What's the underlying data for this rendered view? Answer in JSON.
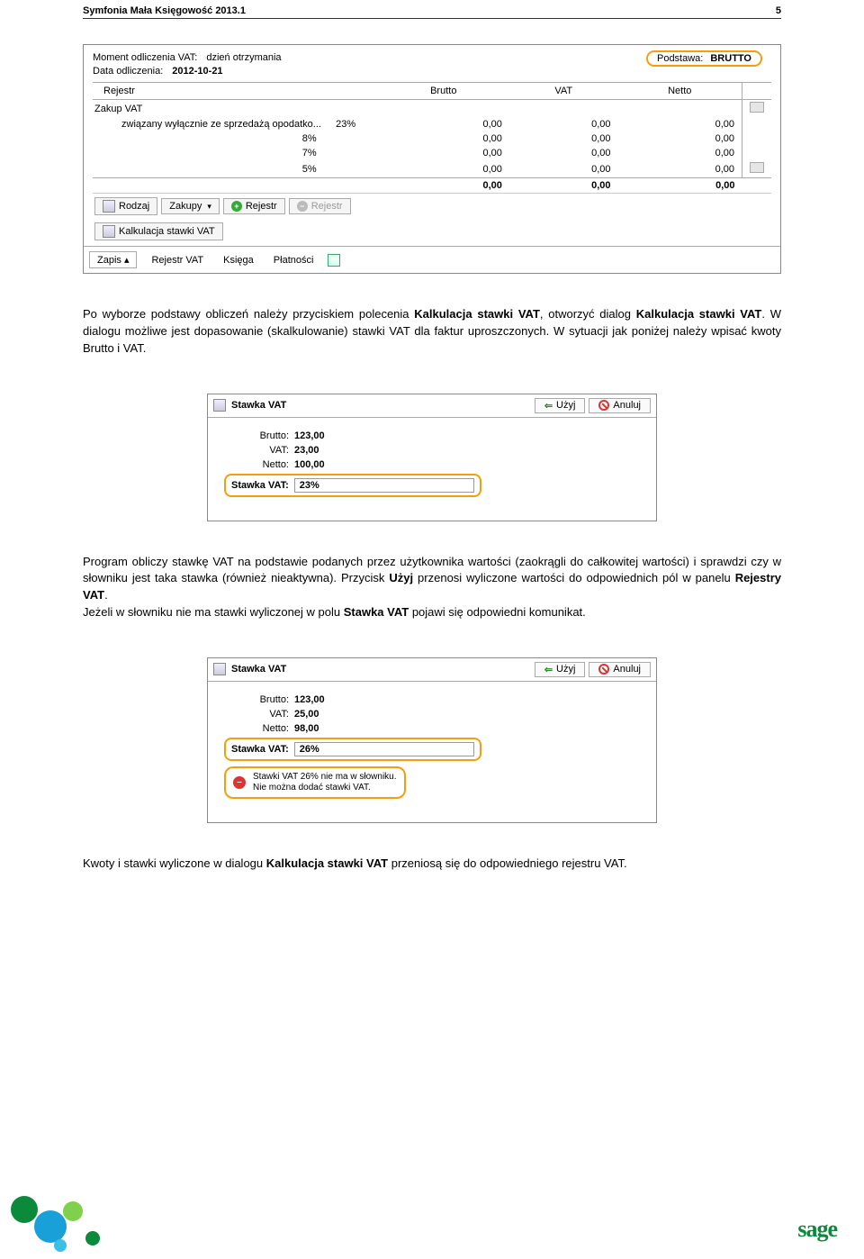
{
  "header": {
    "title": "Symfonia Mała Księgowość 2013.1",
    "page_number": "5"
  },
  "screenshot1": {
    "moment_label": "Moment odliczenia VAT:",
    "moment_value": "dzień otrzymania",
    "data_label": "Data odliczenia:",
    "data_value": "2012-10-21",
    "podstawa_label": "Podstawa:",
    "podstawa_value": "BRUTTO",
    "columns": {
      "rejestr": "Rejestr",
      "brutto": "Brutto",
      "vat": "VAT",
      "netto": "Netto"
    },
    "group_label": "Zakup VAT",
    "group_sub": "związany wyłącznie ze sprzedażą opodatko...",
    "rows": [
      {
        "rate": "23%",
        "brutto": "0,00",
        "vat": "0,00",
        "netto": "0,00"
      },
      {
        "rate": "8%",
        "brutto": "0,00",
        "vat": "0,00",
        "netto": "0,00"
      },
      {
        "rate": "7%",
        "brutto": "0,00",
        "vat": "0,00",
        "netto": "0,00"
      },
      {
        "rate": "5%",
        "brutto": "0,00",
        "vat": "0,00",
        "netto": "0,00"
      }
    ],
    "totals": {
      "brutto": "0,00",
      "vat": "0,00",
      "netto": "0,00"
    },
    "toolbar": {
      "rodzaj": "Rodzaj",
      "zakupy": "Zakupy",
      "rejestr_add": "Rejestr",
      "rejestr_del": "Rejestr",
      "kalkulacja": "Kalkulacja stawki VAT"
    },
    "bottom": {
      "zapis": "Zapis",
      "rejestr_vat": "Rejestr VAT",
      "ksiega": "Księga",
      "platnosci": "Płatności"
    }
  },
  "paragraphs": {
    "p1a": "Po wyborze podstawy obliczeń należy przyciskiem polecenia ",
    "p1b": "Kalkulacja stawki VAT",
    "p1c": ", otworzyć dialog ",
    "p1d": "Kalkulacja stawki VAT",
    "p1e": ". W dialogu możliwe jest dopasowanie (skalkulowanie) stawki VAT dla faktur uproszczonych. W sytuacji jak poniżej należy wpisać kwoty Brutto i VAT.",
    "p2a": "Program obliczy stawkę VAT na podstawie podanych przez użytkownika wartości (zaokrągli do całkowitej wartości) i sprawdzi czy w słowniku jest taka stawka (również nieaktywna). Przycisk ",
    "p2b": "Użyj",
    "p2c": " przenosi wyliczone wartości do odpowiednich pól w panelu ",
    "p2d": "Rejestry VAT",
    "p2e": ".",
    "p3a": "Jeżeli w słowniku nie ma stawki wyliczonej w polu ",
    "p3b": "Stawka VAT",
    "p3c": " pojawi się odpowiedni komunikat.",
    "p4a": "Kwoty i stawki wyliczone w dialogu ",
    "p4b": "Kalkulacja stawki VAT",
    "p4c": " przeniosą się do odpowiedniego rejestru VAT."
  },
  "dialog": {
    "title": "Stawka VAT",
    "btn_use": "Użyj",
    "btn_cancel": "Anuluj",
    "brutto_label": "Brutto:",
    "vat_label": "VAT:",
    "netto_label": "Netto:",
    "stawka_label": "Stawka VAT:"
  },
  "dialog1": {
    "brutto": "123,00",
    "vat": "23,00",
    "netto": "100,00",
    "stawka": "23%"
  },
  "dialog2": {
    "brutto": "123,00",
    "vat": "25,00",
    "netto": "98,00",
    "stawka": "26%",
    "err1": "Stawki VAT 26% nie ma w słowniku.",
    "err2": "Nie można dodać stawki VAT."
  },
  "footer": {
    "logo": "sage"
  }
}
